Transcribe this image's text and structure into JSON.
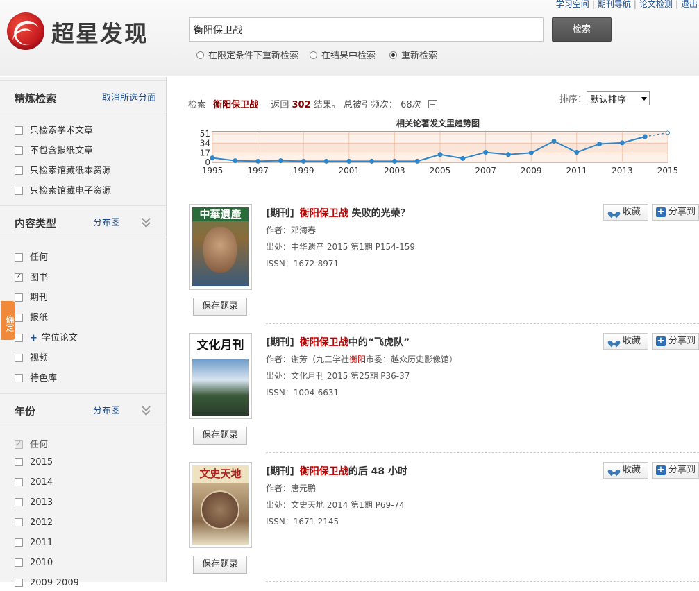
{
  "header": {
    "logo_text": "超星发现",
    "top_links": [
      "学习空间",
      "期刊导航",
      "论文检测",
      "退出"
    ],
    "search_value": "衡阳保卫战",
    "search_button": "检索",
    "radios": [
      {
        "label": "在限定条件下重新检索",
        "selected": false
      },
      {
        "label": "在结果中检索",
        "selected": false
      },
      {
        "label": "重新检索",
        "selected": true
      }
    ]
  },
  "sidebar": {
    "refine": {
      "title": "精炼检索",
      "clear_link": "取消所选分面",
      "options": [
        "只检索学术文章",
        "不包含报纸文章",
        "只检索馆藏纸本资源",
        "只检索馆藏电子资源"
      ]
    },
    "content_type": {
      "title": "内容类型",
      "chart_link": "分布图",
      "options": [
        {
          "label": "任何",
          "checked": false
        },
        {
          "label": "图书",
          "checked": true
        },
        {
          "label": "期刊",
          "checked": false
        },
        {
          "label": "报纸",
          "checked": false
        },
        {
          "label": "学位论文",
          "checked": false,
          "expand": true
        },
        {
          "label": "视频",
          "checked": false
        },
        {
          "label": "特色库",
          "checked": false
        }
      ]
    },
    "year": {
      "title": "年份",
      "chart_link": "分布图",
      "options": [
        "任何",
        "2015",
        "2014",
        "2013",
        "2012",
        "2011",
        "2010",
        "2009-2009"
      ]
    },
    "confirm_tab": "确定"
  },
  "summary": {
    "search_label": "检索",
    "query": "衡阳保卫战",
    "return_label": "返回",
    "count": "302",
    "result_label": "结果。",
    "cited_label": "总被引频次：",
    "cited_count": "68次"
  },
  "sort": {
    "label": "排序：",
    "value": "默认排序"
  },
  "chart_data": {
    "type": "line",
    "title": "相关论著发文里趋势图",
    "x": [
      1995,
      1996,
      1997,
      1998,
      1999,
      2000,
      2001,
      2002,
      2003,
      2004,
      2005,
      2006,
      2007,
      2008,
      2009,
      2010,
      2011,
      2012,
      2013,
      2014,
      2015
    ],
    "values": [
      8,
      3,
      2,
      3,
      2,
      2,
      2,
      2,
      2,
      2,
      14,
      7,
      18,
      14,
      17,
      38,
      18,
      33,
      35,
      46,
      53
    ],
    "xticks": [
      "1995",
      "1997",
      "1999",
      "2001",
      "2003",
      "2005",
      "2007",
      "2009",
      "2011",
      "2013",
      "2015"
    ],
    "yticks": [
      "0",
      "17",
      "34",
      "51"
    ],
    "ylim": [
      0,
      51
    ],
    "grid": true,
    "color": "#2f86c8"
  },
  "results": [
    {
      "type": "[期刊]",
      "title_hl": "衡阳保卫战",
      "title_rest": " 失败的光荣？",
      "author_label": "作者：",
      "author": "邓海春",
      "author_extra": "",
      "source_label": "出处：",
      "source": "中华遗产 2015 第1期 P154-159",
      "issn_label": "ISSN：",
      "issn": "1672-8971",
      "cover_title": "中華遺產",
      "save": "保存题录",
      "fav": "收藏",
      "share": "分享到"
    },
    {
      "type": "[期刊]",
      "title_hl": "衡阳保卫战",
      "title_rest": "中的“飞虎队”",
      "author_label": "作者：",
      "author": "谢芳（九三学社",
      "author_hl": "衡阳",
      "author_extra": "市委；越众历史影像馆）",
      "source_label": "出处：",
      "source": "文化月刊 2015 第25期 P36-37",
      "issn_label": "ISSN：",
      "issn": "1004-6631",
      "cover_title": "文化月刊",
      "save": "保存题录",
      "fav": "收藏",
      "share": "分享到"
    },
    {
      "type": "[期刊]",
      "title_hl": "衡阳保卫战",
      "title_rest": "的后 48 小时",
      "author_label": "作者：",
      "author": "唐元鹏",
      "author_extra": "",
      "source_label": "出处：",
      "source": "文史天地 2014 第1期 P69-74",
      "issn_label": "ISSN：",
      "issn": "1671-2145",
      "cover_title": "文史天地",
      "save": "保存题录",
      "fav": "收藏",
      "share": "分享到"
    }
  ]
}
